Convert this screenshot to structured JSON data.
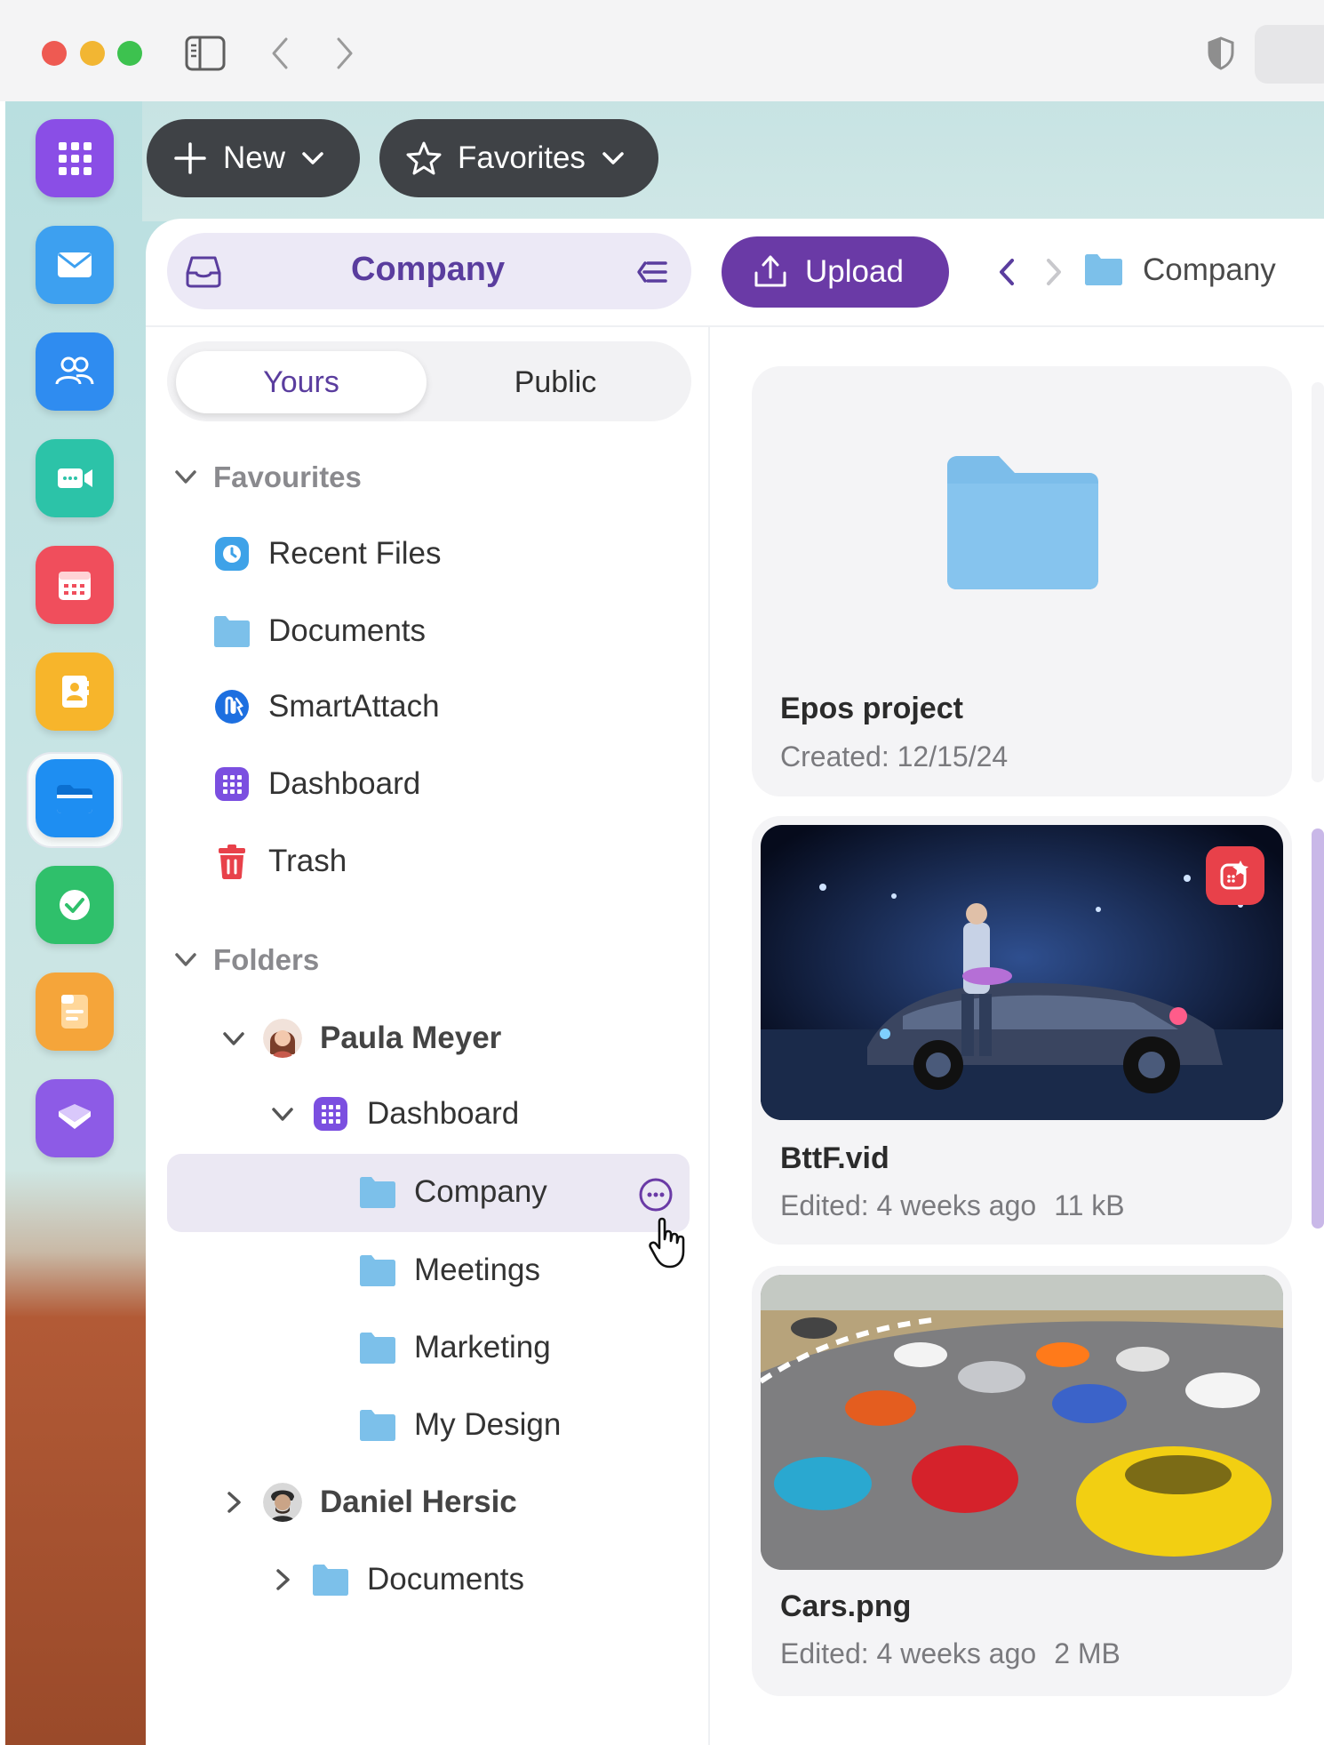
{
  "toolbar": {
    "new_label": "New",
    "favorites_label": "Favorites"
  },
  "header": {
    "title": "Company",
    "upload_label": "Upload",
    "breadcrumb_current": "Company"
  },
  "tabs": {
    "yours": "Yours",
    "public": "Public"
  },
  "sidebar": {
    "favourites_heading": "Favourites",
    "favourites": [
      {
        "label": "Recent Files",
        "icon": "clock-icon"
      },
      {
        "label": "Documents",
        "icon": "folder-icon"
      },
      {
        "label": "SmartAttach",
        "icon": "smartattach-icon"
      },
      {
        "label": "Dashboard",
        "icon": "dashboard-icon"
      },
      {
        "label": "Trash",
        "icon": "trash-icon"
      }
    ],
    "folders_heading": "Folders",
    "folders": {
      "paula": "Paula Meyer",
      "dashboard": "Dashboard",
      "company": "Company",
      "meetings": "Meetings",
      "marketing": "Marketing",
      "my_design": "My Design",
      "daniel": "Daniel Hersic",
      "documents": "Documents"
    }
  },
  "files": [
    {
      "title": "Epos project",
      "meta": "Created: 12/15/24",
      "size": ""
    },
    {
      "title": "BttF.vid",
      "meta": "Edited: 4 weeks ago",
      "size": "11 kB"
    },
    {
      "title": "Cars.png",
      "meta": "Edited: 4 weeks ago",
      "size": "2 MB"
    }
  ],
  "colors": {
    "accent": "#6a3aa6",
    "accent_text": "#5a3d9e",
    "folder": "#7cc0ea",
    "dark_pill": "#3f4246"
  }
}
